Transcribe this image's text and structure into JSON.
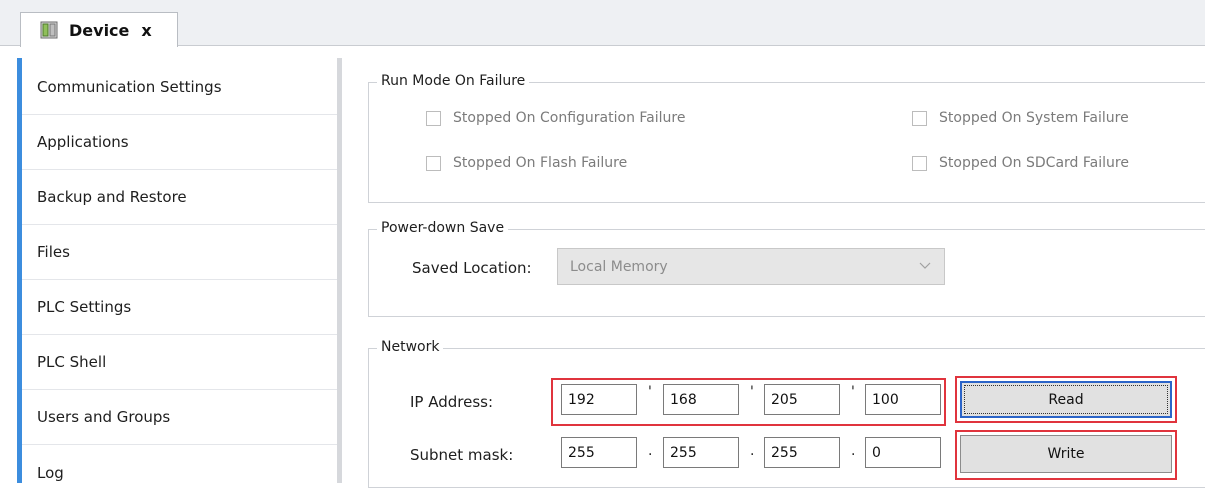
{
  "tab": {
    "label": "Device",
    "close": "x"
  },
  "sidebar": {
    "items": [
      {
        "label": "Communication Settings"
      },
      {
        "label": "Applications"
      },
      {
        "label": "Backup and Restore"
      },
      {
        "label": "Files"
      },
      {
        "label": "PLC Settings"
      },
      {
        "label": "PLC Shell"
      },
      {
        "label": "Users and Groups"
      },
      {
        "label": "Log"
      }
    ]
  },
  "run_mode": {
    "title": "Run Mode On Failure",
    "options": [
      {
        "label": "Stopped On Configuration Failure",
        "checked": false
      },
      {
        "label": "Stopped On System Failure",
        "checked": false
      },
      {
        "label": "Stopped On Flash Failure",
        "checked": false
      },
      {
        "label": "Stopped On SDCard Failure",
        "checked": false
      }
    ]
  },
  "power_down": {
    "title": "Power-down Save",
    "saved_location_label": "Saved Location:",
    "saved_location_value": "Local Memory"
  },
  "network": {
    "title": "Network",
    "ip_label": "IP Address:",
    "ip": [
      "192",
      "168",
      "205",
      "100"
    ],
    "ip_sep": "'",
    "subnet_label": "Subnet mask:",
    "subnet": [
      "255",
      "255",
      "255",
      "0"
    ],
    "subnet_sep": ".",
    "read_label": "Read",
    "write_label": "Write"
  },
  "colors": {
    "accent": "#3c8dde",
    "highlight": "#e0343d"
  }
}
